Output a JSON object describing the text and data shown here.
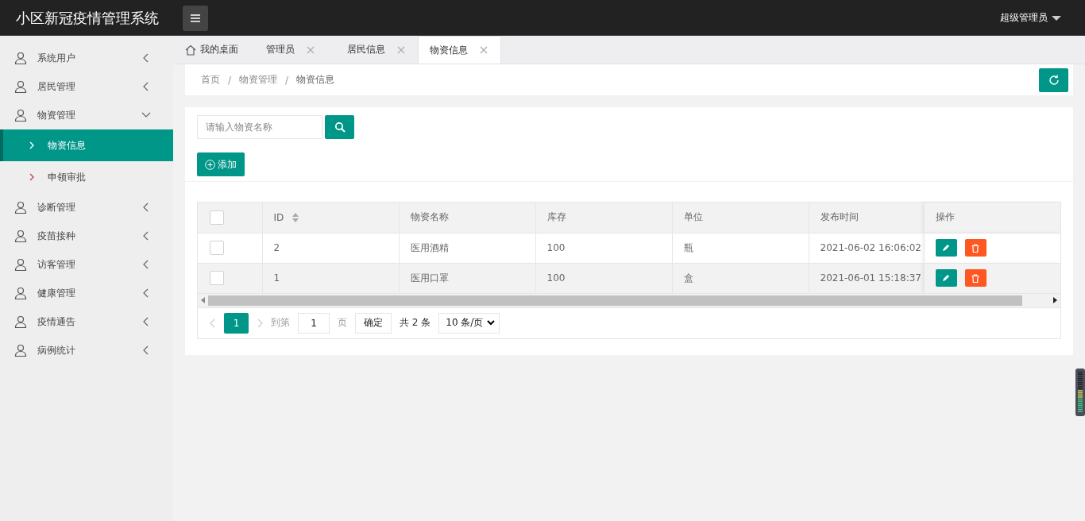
{
  "header": {
    "title": "小区新冠疫情管理系统",
    "user": "超级管理员"
  },
  "sidebar": {
    "items": [
      {
        "label": "系统用户",
        "expanded": false
      },
      {
        "label": "居民管理",
        "expanded": false
      },
      {
        "label": "物资管理",
        "expanded": true,
        "children": [
          {
            "label": "物资信息",
            "selected": true
          },
          {
            "label": "申领审批",
            "selected": false
          }
        ]
      },
      {
        "label": "诊断管理",
        "expanded": false
      },
      {
        "label": "疫苗接种",
        "expanded": false
      },
      {
        "label": "访客管理",
        "expanded": false
      },
      {
        "label": "健康管理",
        "expanded": false
      },
      {
        "label": "疫情通告",
        "expanded": false
      },
      {
        "label": "病例统计",
        "expanded": false
      }
    ]
  },
  "tabs": [
    {
      "label": "我的桌面",
      "kind": "home",
      "selected": false
    },
    {
      "label": "管理员",
      "kind": "closable",
      "selected": false
    },
    {
      "label": "居民信息",
      "kind": "closable",
      "selected": false
    },
    {
      "label": "物资信息",
      "kind": "closable",
      "selected": true
    }
  ],
  "breadcrumb": {
    "separator": "/",
    "items": [
      "首页",
      "物资管理",
      "物资信息"
    ]
  },
  "search": {
    "placeholder": "请输入物资名称"
  },
  "add_button": "添加",
  "table": {
    "select_all_checked": false,
    "columns": [
      "ID",
      "物资名称",
      "库存",
      "单位",
      "发布时间",
      "操作"
    ],
    "rows": [
      {
        "checked": false,
        "cells": [
          "2",
          "医用酒精",
          "100",
          "瓶",
          "2021-06-02 16:06:02"
        ]
      },
      {
        "checked": false,
        "cells": [
          "1",
          "医用口罩",
          "100",
          "盒",
          "2021-06-01 15:18:37"
        ]
      }
    ]
  },
  "pagination": {
    "pages": [
      {
        "label": "1",
        "selected": true
      }
    ],
    "goto_label": "到第",
    "goto_value": "1",
    "page_unit": "页",
    "confirm": "确定",
    "total": "共 2 条",
    "page_size": "10 条/页"
  }
}
